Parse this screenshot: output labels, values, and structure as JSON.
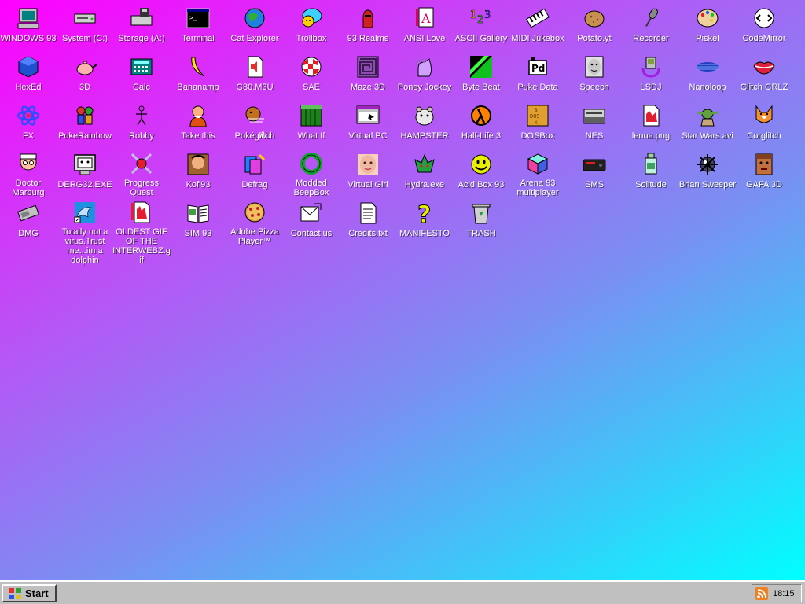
{
  "desktop": {
    "gradient_colors": [
      "#ff00ff",
      "#c04cf6",
      "#7a8ff2",
      "#00ffff"
    ],
    "icons": [
      {
        "label": "WINDOWS 93",
        "icon": "computer-icon"
      },
      {
        "label": "System (C:)",
        "icon": "drive-icon"
      },
      {
        "label": "Storage (A:)",
        "icon": "floppy-drive-icon"
      },
      {
        "label": "Terminal",
        "icon": "terminal-icon"
      },
      {
        "label": "Cat Explorer",
        "icon": "cat-globe-icon"
      },
      {
        "label": "Trollbox",
        "icon": "chat-bubble-icon"
      },
      {
        "label": "93 Realms",
        "icon": "knight-icon"
      },
      {
        "label": "ANSI Love",
        "icon": "letter-a-icon"
      },
      {
        "label": "ASCII Gallery",
        "icon": "numbers-icon"
      },
      {
        "label": "MIDI Jukebox",
        "icon": "piano-icon"
      },
      {
        "label": "Potato.yt",
        "icon": "potato-icon"
      },
      {
        "label": "Recorder",
        "icon": "microphone-icon"
      },
      {
        "label": "Piskel",
        "icon": "palette-icon"
      },
      {
        "label": "CodeMirror",
        "icon": "code-icon"
      },
      {
        "label": "HexEd",
        "icon": "cube-icon"
      },
      {
        "label": "3D",
        "icon": "teapot-icon"
      },
      {
        "label": "Calc",
        "icon": "calculator-icon"
      },
      {
        "label": "Bananamp",
        "icon": "banana-icon"
      },
      {
        "label": "G80.M3U",
        "icon": "audio-file-icon"
      },
      {
        "label": "SAE",
        "icon": "amiga-ball-icon"
      },
      {
        "label": "Maze 3D",
        "icon": "maze-icon"
      },
      {
        "label": "Poney Jockey",
        "icon": "pony-icon"
      },
      {
        "label": "Byte Beat",
        "icon": "green-wave-icon"
      },
      {
        "label": "Puke Data",
        "icon": "pd-icon"
      },
      {
        "label": "Speech",
        "icon": "face-icon"
      },
      {
        "label": "LSDJ",
        "icon": "gameboy-icon"
      },
      {
        "label": "Nanoloop",
        "icon": "wave-lines-icon"
      },
      {
        "label": "Glitch GRLZ",
        "icon": "lips-icon"
      },
      {
        "label": "FX",
        "icon": "atom-icon"
      },
      {
        "label": "PokeRainbow",
        "icon": "pokemon-trainers-icon"
      },
      {
        "label": "Robby",
        "icon": "stick-figure-icon"
      },
      {
        "label": "Take this",
        "icon": "old-man-icon"
      },
      {
        "label": "Pokégl̸i̸t̸c̸h",
        "icon": "pokegl-icon"
      },
      {
        "label": "What If",
        "icon": "grid-window-icon"
      },
      {
        "label": "Virtual PC",
        "icon": "window-pc-icon"
      },
      {
        "label": "HAMPSTER",
        "icon": "hamster-icon"
      },
      {
        "label": "Half-Life 3",
        "icon": "lambda-icon"
      },
      {
        "label": "DOSBox",
        "icon": "dosbox-icon"
      },
      {
        "label": "NES",
        "icon": "nes-icon"
      },
      {
        "label": "lenna.png",
        "icon": "image-file-icon"
      },
      {
        "label": "Star Wars.avi",
        "icon": "yoda-icon"
      },
      {
        "label": "Corglitch",
        "icon": "corgi-icon"
      },
      {
        "label": "Doctor Marburg",
        "icon": "doctor-icon"
      },
      {
        "label": "DERG32.EXE",
        "icon": "computer-face-icon"
      },
      {
        "label": "Progress Quest",
        "icon": "crossed-swords-icon"
      },
      {
        "label": "Kof'93",
        "icon": "fighter-icon"
      },
      {
        "label": "Defrag",
        "icon": "defrag-icon"
      },
      {
        "label": "Modded BeepBox",
        "icon": "ring-icon"
      },
      {
        "label": "Virtual Girl",
        "icon": "girl-face-icon"
      },
      {
        "label": "Hydra.exe",
        "icon": "dragon-icon"
      },
      {
        "label": "Acid Box 93",
        "icon": "smiley-icon"
      },
      {
        "label": "Arena 93 multiplayer",
        "icon": "iso-cube-icon"
      },
      {
        "label": "SMS",
        "icon": "console-icon"
      },
      {
        "label": "Solitude",
        "icon": "bottle-icon"
      },
      {
        "label": "Brian Sweeper",
        "icon": "mine-icon"
      },
      {
        "label": "GAFA 3D",
        "icon": "doom-face-icon"
      },
      {
        "label": "DMG",
        "icon": "dmg-icon"
      },
      {
        "label": "Totally not a virus.Trust me...im a dolphin",
        "icon": "dolphin-icon"
      },
      {
        "label": "OLDEST GIF OF THE INTERWEBZ.gif",
        "icon": "gif-file-icon"
      },
      {
        "label": "SIM 93",
        "icon": "book-icon"
      },
      {
        "label": "Adobe Pizza Player™",
        "icon": "pizza-icon"
      },
      {
        "label": "Contact us",
        "icon": "letter-icon"
      },
      {
        "label": "Credits.txt",
        "icon": "text-file-icon"
      },
      {
        "label": "MANIFESTO",
        "icon": "question-mark-icon"
      },
      {
        "label": "TRASH",
        "icon": "recycle-bin-icon"
      }
    ]
  },
  "taskbar": {
    "start_label": "Start",
    "clock": "18:15",
    "tray_icon": "rss-icon"
  }
}
